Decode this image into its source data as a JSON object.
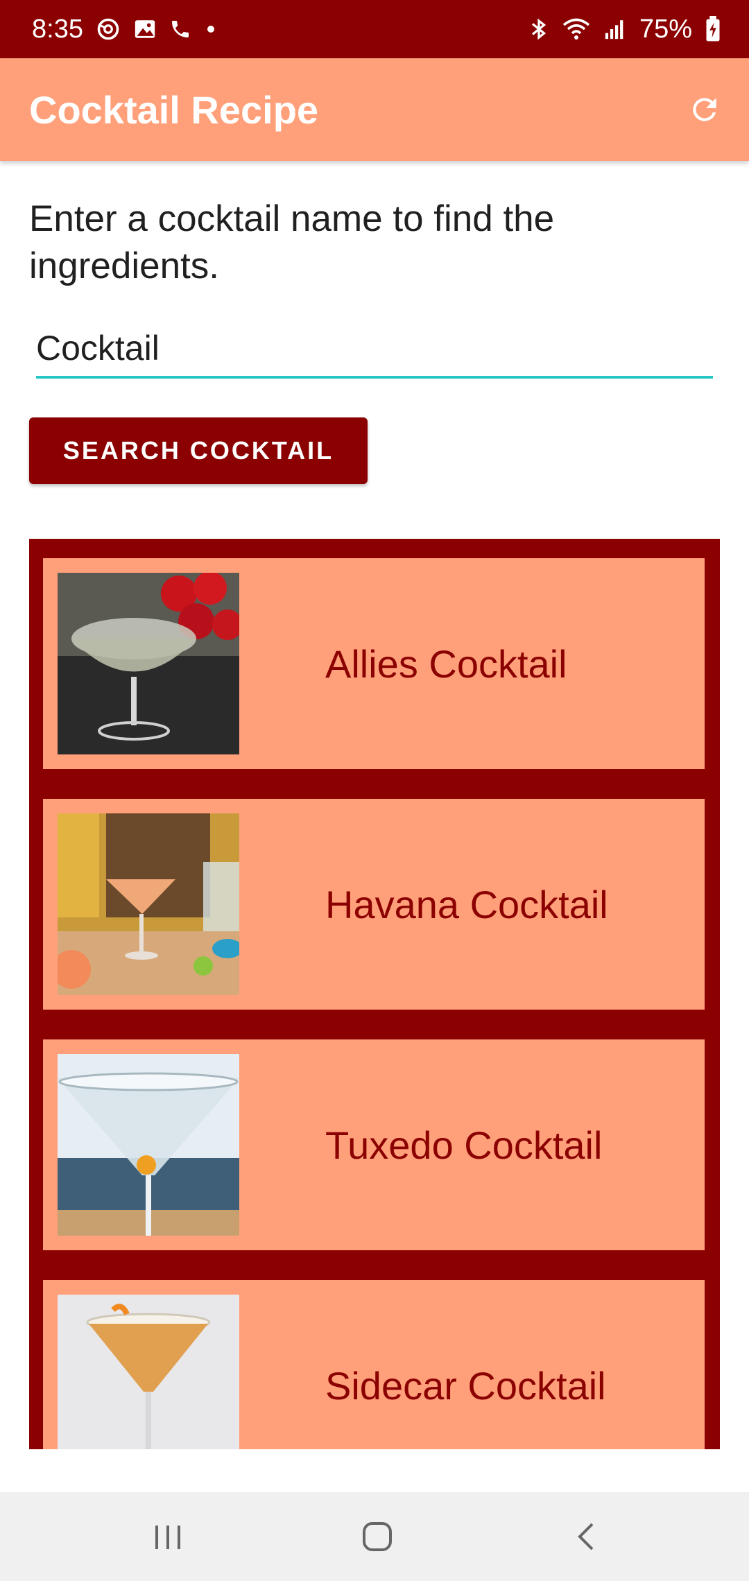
{
  "status_bar": {
    "time": "8:35",
    "battery": "75%",
    "left_icons": [
      "sync-icon",
      "gallery-icon",
      "phone-icon",
      "dot-icon"
    ],
    "right_icons": [
      "bluetooth-icon",
      "wifi-icon",
      "signal-icon",
      "battery-charging-icon"
    ]
  },
  "app_bar": {
    "title": "Cocktail Recipe",
    "refresh_icon": "refresh-icon"
  },
  "prompt": "Enter a cocktail name to find the ingredients.",
  "search": {
    "value": "Cocktail",
    "button_label": "SEARCH COCKTAIL"
  },
  "results": [
    {
      "name": "Allies Cocktail",
      "thumb": "coupe-glass-photo"
    },
    {
      "name": "Havana Cocktail",
      "thumb": "coupe-glass-photo"
    },
    {
      "name": "Tuxedo Cocktail",
      "thumb": "martini-glass-photo"
    },
    {
      "name": "Sidecar Cocktail",
      "thumb": "martini-glass-photo"
    }
  ],
  "nav_bar": {
    "buttons": [
      "recent-apps-icon",
      "home-icon",
      "back-icon"
    ]
  },
  "colors": {
    "primary_dark": "#8b0000",
    "primary_light": "#ffa07a",
    "accent": "#26c6c6"
  }
}
